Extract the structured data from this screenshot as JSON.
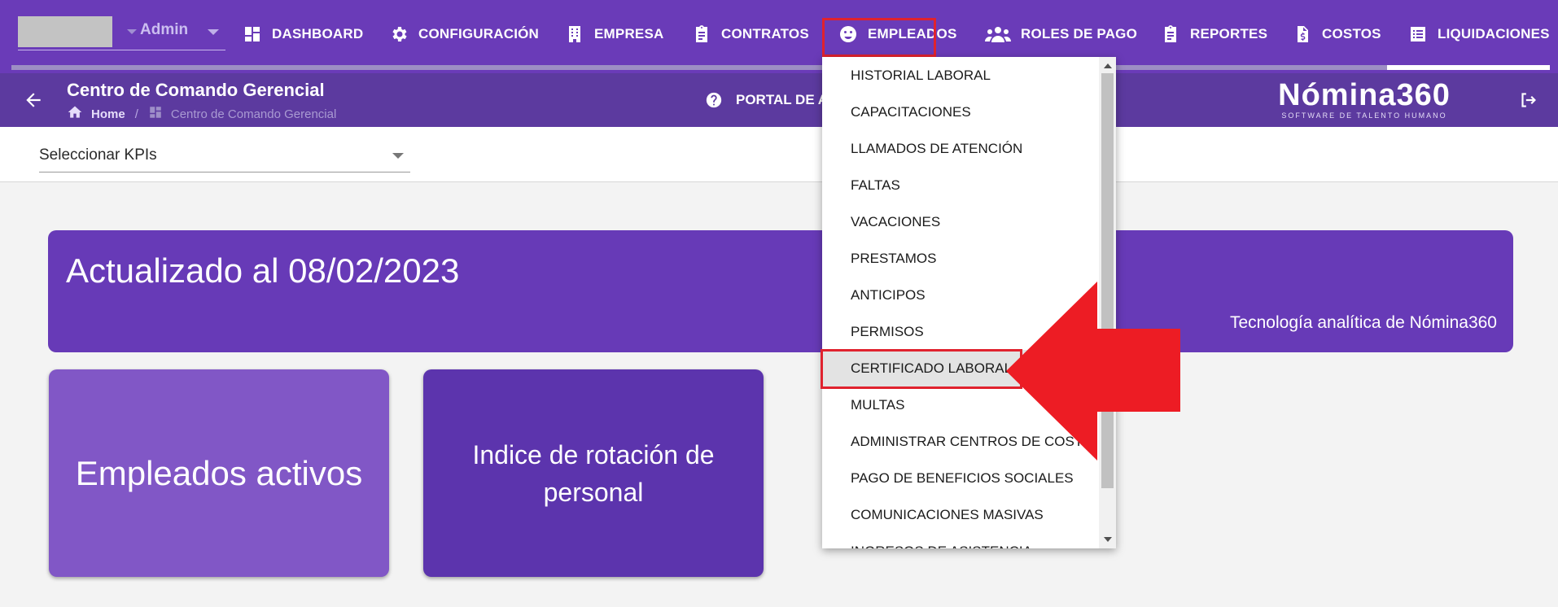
{
  "topbar": {
    "user_label": "Admin",
    "nav": [
      {
        "label": "DASHBOARD",
        "icon": "dashboard-icon"
      },
      {
        "label": "CONFIGURACIÓN",
        "icon": "gear-icon"
      },
      {
        "label": "EMPRESA",
        "icon": "building-icon"
      },
      {
        "label": "CONTRATOS",
        "icon": "clipboard-icon"
      },
      {
        "label": "EMPLEADOS",
        "icon": "face-icon",
        "active": true
      },
      {
        "label": "ROLES DE PAGO",
        "icon": "people-icon"
      },
      {
        "label": "REPORTES",
        "icon": "clipboard-icon"
      },
      {
        "label": "COSTOS",
        "icon": "invoice-icon"
      },
      {
        "label": "LIQUIDACIONES",
        "icon": "list-icon"
      }
    ]
  },
  "subbar": {
    "page_title": "Centro de Comando Gerencial",
    "breadcrumb": {
      "home": "Home",
      "separator": "/",
      "current": "Centro de Comando Gerencial"
    },
    "portal_label": "PORTAL DE A",
    "brand_name": "Nómina360",
    "brand_tagline": "SOFTWARE DE TALENTO HUMANO"
  },
  "kpi": {
    "select_label": "Seleccionar KPIs"
  },
  "banner": {
    "title": "Actualizado al 08/02/2023",
    "subtitle": "Tecnología analítica de Nómina360"
  },
  "cards": [
    {
      "label": "Empleados activos"
    },
    {
      "label": "Indice de rotación de personal"
    }
  ],
  "dropdown": {
    "items": [
      "HISTORIAL LABORAL",
      "CAPACITACIONES",
      "LLAMADOS DE ATENCIÓN",
      "FALTAS",
      "VACACIONES",
      "PRESTAMOS",
      "ANTICIPOS",
      "PERMISOS",
      "CERTIFICADO LABORAL",
      "MULTAS",
      "ADMINISTRAR CENTROS DE COSTO",
      "PAGO DE BENEFICIOS SOCIALES",
      "COMUNICACIONES MASIVAS",
      "INGRESOS DE ASISTENCIA"
    ],
    "highlighted_item": "CERTIFICADO LABORAL"
  },
  "colors": {
    "primary": "#6a3bb8",
    "secondary": "#5c3a9f",
    "annotation_red": "#e0222e"
  }
}
